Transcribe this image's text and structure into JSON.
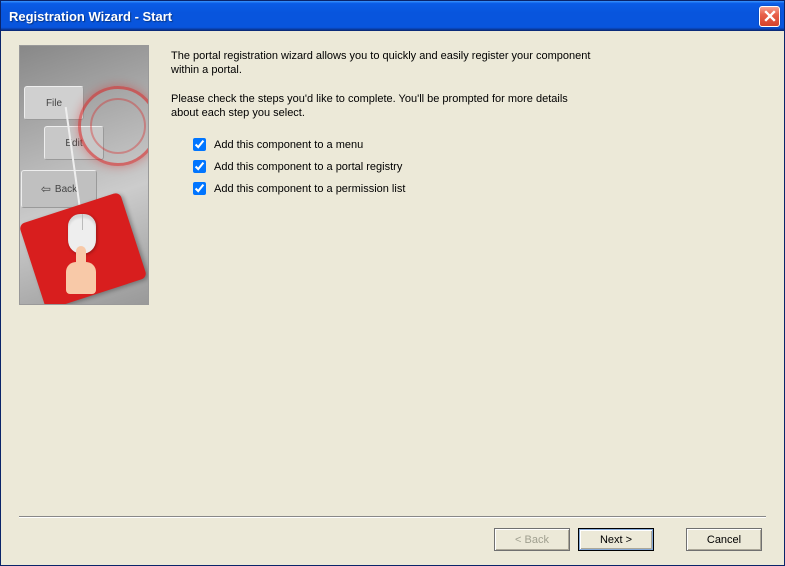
{
  "window": {
    "title": "Registration Wizard - Start"
  },
  "intro": {
    "p1": "The portal registration wizard allows you to quickly and easily register your component within a portal.",
    "p2": "Please check the steps you'd like to complete.  You'll be prompted for more details about each step you select."
  },
  "checks": [
    {
      "label": "Add this component to a menu",
      "checked": true
    },
    {
      "label": "Add this component to a portal registry",
      "checked": true
    },
    {
      "label": "Add this component to a permission list",
      "checked": true
    }
  ],
  "illustration": {
    "btn_file": "File",
    "btn_edit": "Edit",
    "btn_back": "Back"
  },
  "buttons": {
    "back": "< Back",
    "next": "Next >",
    "cancel": "Cancel"
  }
}
